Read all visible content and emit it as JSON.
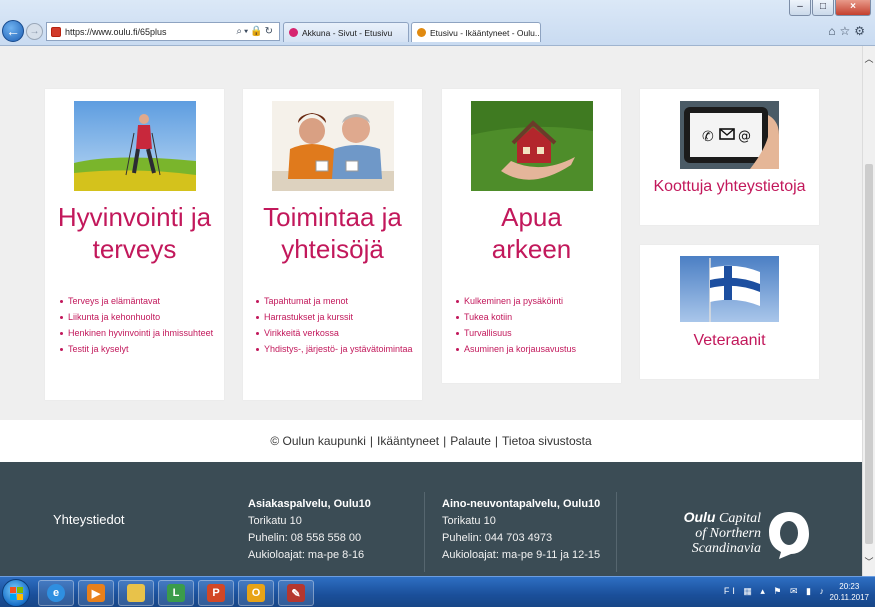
{
  "browser": {
    "window_controls": [
      "–",
      "□",
      "×"
    ],
    "address_url": "https://www.oulu.fi/65plus",
    "tabs": [
      {
        "label": "Akkuna - Sivut - Etusivu",
        "color": "#d6246f"
      },
      {
        "label": "Etusivu - Ikääntyneet - Oulu...",
        "color": "#e08a10"
      }
    ]
  },
  "cards": [
    {
      "title": "Hyvinvointi ja terveys",
      "image": "woman-nordic-walking-meadow",
      "items": [
        "Terveys ja elämäntavat",
        "Liikunta ja kehonhuolto",
        "Henkinen hyvinvointi ja ihmissuhteet",
        "Testit ja kyselyt"
      ]
    },
    {
      "title": "Toimintaa ja yhteisöjä",
      "image": "senior-couple-drinking-coffee",
      "items": [
        "Tapahtumat ja menot",
        "Harrastukset ja kurssit",
        "Virikkeitä verkossa",
        "Yhdistys-, järjestö- ja ystävätoimintaa"
      ]
    },
    {
      "title": "Apua arkeen",
      "image": "hands-holding-house",
      "items": [
        "Kulkeminen ja pysäköinti",
        "Tukea kotiin",
        "Turvallisuus",
        "Asuminen ja korjausavustus"
      ]
    }
  ],
  "side_cards": [
    {
      "title": "Koottuja yhteystietoja",
      "image": "phone-contact-icons"
    },
    {
      "title": "Veteraanit",
      "image": "finnish-flag"
    }
  ],
  "footer_links": [
    "© Oulun kaupunki",
    "Ikääntyneet",
    "Palaute",
    "Tietoa sivustosta"
  ],
  "footer": {
    "title": "Yhteystiedot",
    "col1": {
      "heading": "Asiakaspalvelu, Oulu10",
      "lines": [
        "Torikatu 10",
        "Puhelin: 08 558 558 00",
        "Aukioloajat: ma-pe 8-16"
      ]
    },
    "col2": {
      "heading": "Aino-neuvontapalvelu, Oulu10",
      "lines": [
        "Torikatu 10",
        "Puhelin: 044 703 4973",
        "Aukioloajat: ma-pe 9-11 ja 12-15"
      ]
    },
    "logo": {
      "bold": "Oulu",
      "line1": "Capital",
      "line2": "of Northern",
      "line3": "Scandinavia"
    }
  },
  "taskbar": {
    "language": "FI",
    "time": "20:23",
    "date": "20.11.2017"
  },
  "colors": {
    "accent": "#c2185b",
    "footer_bg": "#3b4c55"
  }
}
